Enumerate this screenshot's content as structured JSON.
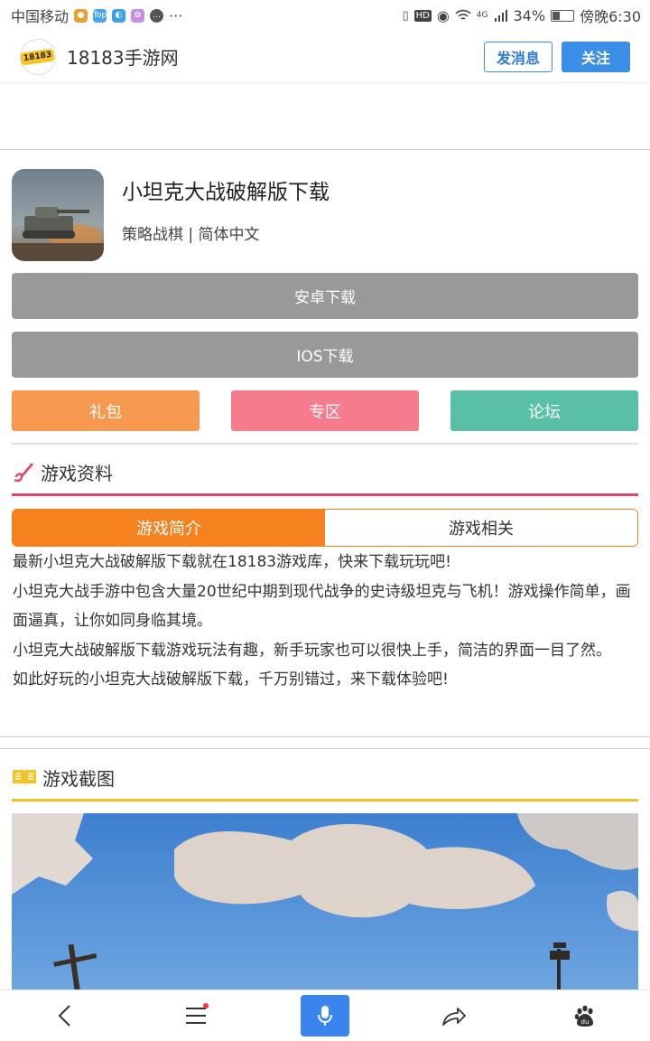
{
  "status_bar": {
    "carrier": "中国移动",
    "notification_icons": [
      "app-icon",
      "top-icon",
      "browser-icon",
      "flower-icon",
      "chat-icon"
    ],
    "more": "···",
    "network": "4G",
    "battery_percent": "34%",
    "battery_level": 0.34,
    "time": "傍晚6:30"
  },
  "header": {
    "logo_text": "18183",
    "site_name": "18183手游网",
    "message_button": "发消息",
    "follow_button": "关注"
  },
  "game": {
    "title": "小坦克大战破解版下载",
    "tags": "策略战棋 | 简体中文"
  },
  "downloads": {
    "android": "安卓下载",
    "ios": "IOS下载"
  },
  "quick_links": [
    {
      "label": "礼包",
      "color": "#f79a4f"
    },
    {
      "label": "专区",
      "color": "#f47c8d"
    },
    {
      "label": "论坛",
      "color": "#58c0a4"
    }
  ],
  "info_section": {
    "title": "游戏资料",
    "accent_color": "#e8456d",
    "tabs": [
      {
        "label": "游戏简介",
        "active": true
      },
      {
        "label": "游戏相关",
        "active": false
      }
    ],
    "paragraphs": [
      "最新小坦克大战破解版下载就在18183游戏库，快来下载玩玩吧!",
      "小坦克大战手游中包含大量20世纪中期到现代战争的史诗级坦克与飞机！游戏操作简单，画面逼真，让你如同身临其境。",
      "小坦克大战破解版下载游戏玩法有趣，新手玩家也可以很快上手，简洁的界面一目了然。",
      "如此好玩的小坦克大战破解版下载，千万别错过，来下载体验吧!"
    ]
  },
  "screenshot_section": {
    "title": "游戏截图",
    "accent_color": "#f2c42c"
  },
  "bottom_nav": {
    "items": [
      "back-icon",
      "menu-icon",
      "mic-icon",
      "share-icon",
      "paw-icon"
    ],
    "accent_color": "#3a84f0"
  }
}
